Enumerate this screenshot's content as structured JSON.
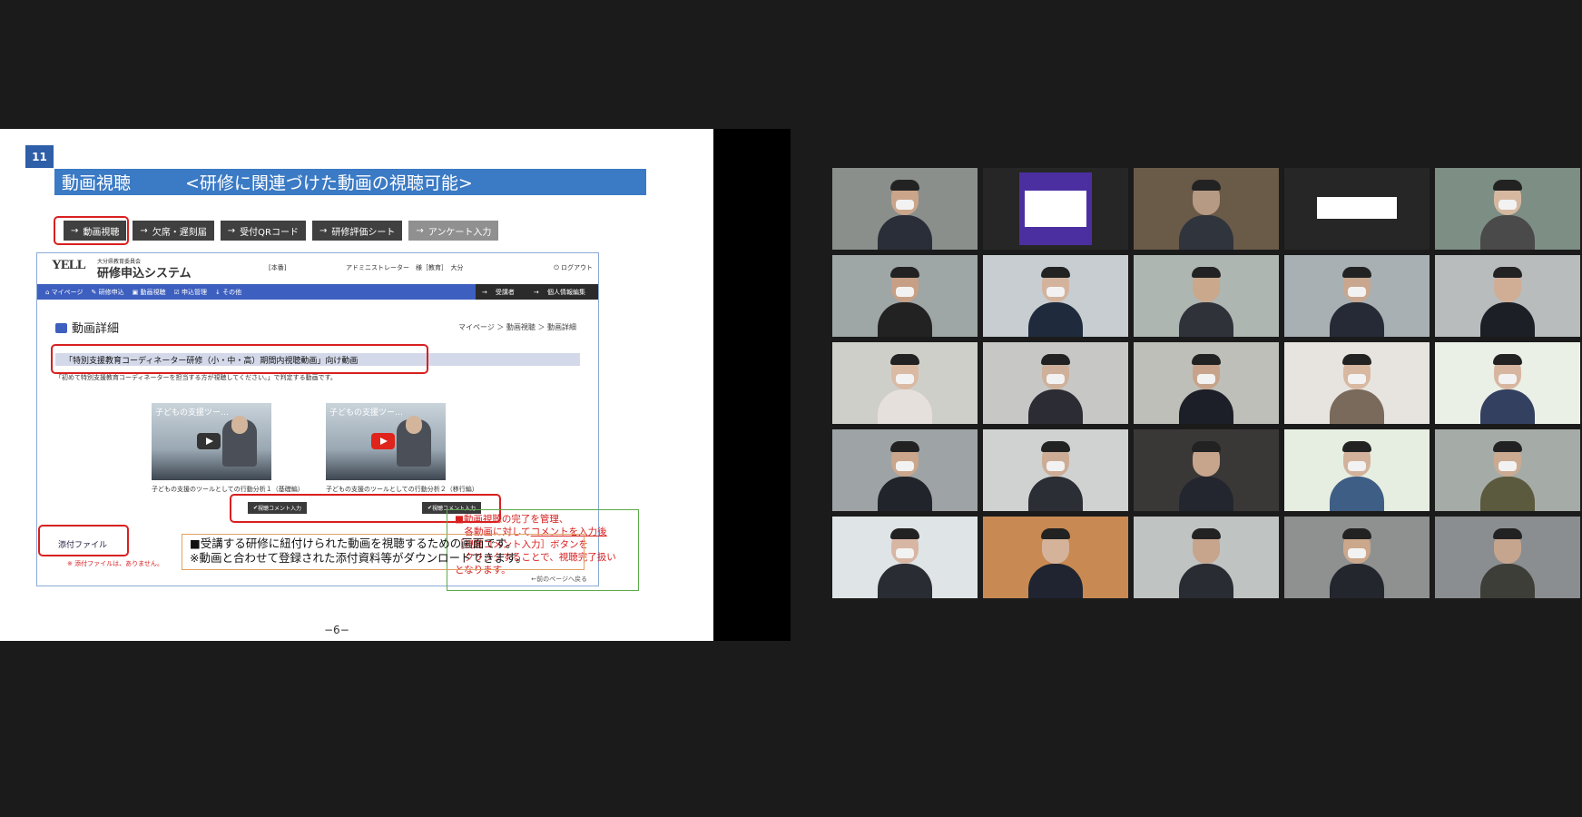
{
  "slide": {
    "page_badge": "11",
    "title": "動画視聴",
    "subtitle": "<研修に関連づけた動画の視聴可能>",
    "tabs": [
      {
        "label": "動画視聴",
        "style": "dark"
      },
      {
        "label": "欠席・遅刻届",
        "style": "dark"
      },
      {
        "label": "受付QRコード",
        "style": "dark"
      },
      {
        "label": "研修評価シート",
        "style": "dark"
      },
      {
        "label": "アンケート入力",
        "style": "grey"
      }
    ],
    "screenshot": {
      "logo": "YELL",
      "org": "大分県教育委員会",
      "system_name": "研修申込システム",
      "env": "[本番]",
      "user": "アドミニストレーター　様［教育］　大分",
      "logout": "ログアウト",
      "nav": [
        "マイページ",
        "研修申込",
        "動画視聴",
        "申込管理",
        "その他"
      ],
      "nav_right": [
        "受講者",
        "個人情報編集"
      ],
      "section_title": "動画詳細",
      "breadcrumb": "マイページ ＞ 動画視聴 ＞ 動画詳細",
      "course_band": "「特別支援教育コーディネーター研修（小・中・高）期間内視聴動画」向け動画",
      "note": "「初めて特別支援教育コーディネーターを担当する方が視聴してください。」で判定する動画です。",
      "videos": [
        {
          "title": "子どもの支援ツー…",
          "caption": "子どもの支援のツールとしての行動分析１（基礎編）"
        },
        {
          "title": "子どもの支援ツー…",
          "caption": "子どもの支援のツールとしての行動分析２（移行編）"
        }
      ],
      "comment_button": "視聴コメント入力",
      "attach_label": "添付ファイル",
      "attach_note": "※ 添付ファイルは、ありません。",
      "back_link": "←前のページへ戻る"
    },
    "callout_lines": [
      "■動画視聴の完了を管理、",
      "各動画に対して",
      "コメントを入力後",
      "［視聴コメント入力］ボタンを",
      "クリックすることで、視聴完了扱い",
      "となります。"
    ],
    "description_lines": [
      "■受講する研修に紐付けられた動画を視聴するための画面です。",
      "※動画と合わせて登録された添付資料等がダウンロードできます。"
    ],
    "footer": "−6−"
  },
  "participants": [
    {
      "bg": "#8a8f8c",
      "suit": "#2a2e38",
      "skin": "#caa58a",
      "mask": true,
      "active": true
    },
    {
      "bg": "#262626",
      "avatar": true
    },
    {
      "bg": "#6a5a48",
      "suit": "#30343c",
      "skin": "#b79a84",
      "mask": false
    },
    {
      "bg": "#262626",
      "label_box": true
    },
    {
      "bg": "#7d8e84",
      "suit": "#4a4a4a",
      "skin": "#d6b8a0",
      "mask": true
    },
    {
      "bg": "#9ea6a6",
      "suit": "#222222",
      "skin": "#c79f84",
      "mask": true
    },
    {
      "bg": "#c7cdd0",
      "suit": "#1f2b3d",
      "skin": "#d3b39c",
      "mask": true
    },
    {
      "bg": "#aeb6b2",
      "suit": "#30323a",
      "skin": "#c9a88c",
      "mask": false
    },
    {
      "bg": "#a8b0b3",
      "suit": "#262a36",
      "skin": "#c9a68e",
      "mask": true
    },
    {
      "bg": "#b9bcbc",
      "suit": "#1d1f26",
      "skin": "#d0ae96",
      "mask": false
    },
    {
      "bg": "#cfcfca",
      "suit": "#e6e0dc",
      "skin": "#dbbaa3",
      "mask": true
    },
    {
      "bg": "#c7c8c6",
      "suit": "#2c2c34",
      "skin": "#cfb09a",
      "mask": true
    },
    {
      "bg": "#bdbfb8",
      "suit": "#1d1f28",
      "skin": "#c6a38a",
      "mask": true
    },
    {
      "bg": "#e7e4df",
      "suit": "#7a6a5c",
      "skin": "#d8b8a0",
      "mask": true
    },
    {
      "bg": "#eaf0e6",
      "suit": "#334060",
      "skin": "#d7b6a0",
      "mask": true
    },
    {
      "bg": "#9ea3a5",
      "suit": "#22242c",
      "skin": "#c9a68c",
      "mask": true
    },
    {
      "bg": "#cfd2d1",
      "suit": "#2b2e34",
      "skin": "#cdac95",
      "mask": true
    },
    {
      "bg": "#3a3837",
      "suit": "#23262e",
      "skin": "#c7a58c",
      "mask": false
    },
    {
      "bg": "#e6eee2",
      "suit": "#3f5e86",
      "skin": "#d3b29c",
      "mask": true
    },
    {
      "bg": "#a5aca7",
      "suit": "#5c5a3e",
      "skin": "#cbaa92",
      "mask": true
    },
    {
      "bg": "#dfe4e6",
      "suit": "#2a2c34",
      "skin": "#d8b6a4",
      "mask": true
    },
    {
      "bg": "#c88a52",
      "suit": "#1f2430",
      "skin": "#d5b39b",
      "mask": false
    },
    {
      "bg": "#bfc3c1",
      "suit": "#2a2c33",
      "skin": "#c7a48c",
      "mask": false
    },
    {
      "bg": "#8e9190",
      "suit": "#24262e",
      "skin": "#cba78c",
      "mask": true
    },
    {
      "bg": "#8a8e90",
      "suit": "#3e3e38",
      "skin": "#c6a58e",
      "mask": false
    }
  ]
}
